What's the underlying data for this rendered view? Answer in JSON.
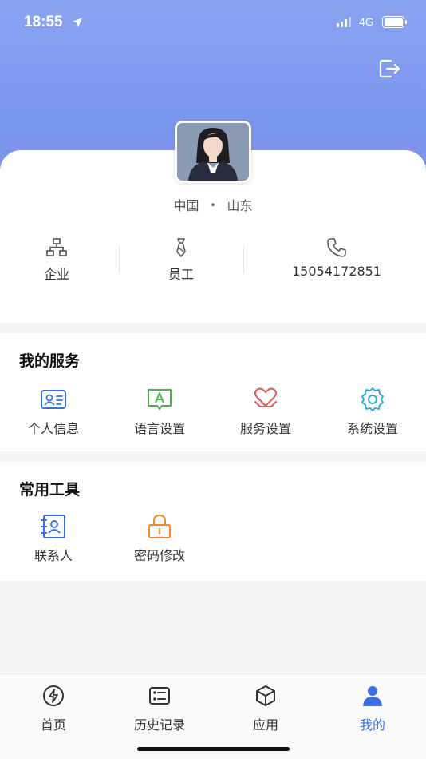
{
  "status_bar": {
    "time": "18:55",
    "location_icon": "location-arrow-icon",
    "network": "4G"
  },
  "header": {
    "logout_icon": "logout-icon"
  },
  "profile": {
    "country": "中国",
    "separator": "•",
    "province": "山东",
    "stats": [
      {
        "icon": "org-chart-icon",
        "label": "企业"
      },
      {
        "icon": "tie-icon",
        "label": "员工"
      },
      {
        "icon": "phone-icon",
        "label": "15054172851"
      }
    ]
  },
  "services": {
    "title": "我的服务",
    "items": [
      {
        "icon": "id-card-icon",
        "label": "个人信息",
        "color": "#3a6fe0"
      },
      {
        "icon": "language-icon",
        "label": "语言设置",
        "color": "#4cb050"
      },
      {
        "icon": "heart-hands-icon",
        "label": "服务设置",
        "color": "#e05a5a"
      },
      {
        "icon": "gear-icon",
        "label": "系统设置",
        "color": "#2aa8d8"
      }
    ]
  },
  "tools": {
    "title": "常用工具",
    "items": [
      {
        "icon": "contacts-icon",
        "label": "联系人",
        "color": "#3a6fe0"
      },
      {
        "icon": "lock-icon",
        "label": "密码修改",
        "color": "#f08a2a"
      }
    ]
  },
  "tabbar": {
    "items": [
      {
        "icon": "lightning-icon",
        "label": "首页",
        "active": false
      },
      {
        "icon": "history-list-icon",
        "label": "历史记录",
        "active": false
      },
      {
        "icon": "cube-icon",
        "label": "应用",
        "active": false
      },
      {
        "icon": "person-icon",
        "label": "我的",
        "active": true
      }
    ],
    "active_color": "#3a6fe0"
  }
}
